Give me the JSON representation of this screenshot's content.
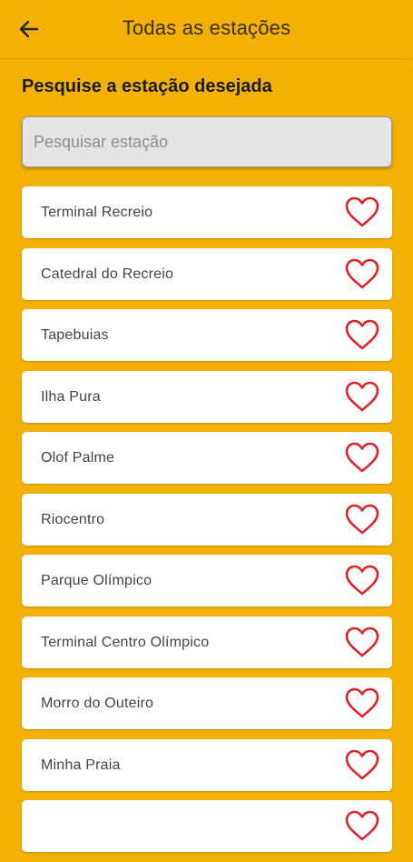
{
  "header": {
    "back_icon": "arrow-left-icon",
    "title": "Todas as estações"
  },
  "search": {
    "heading": "Pesquise a estação desejada",
    "placeholder": "Pesquisar estação",
    "value": ""
  },
  "favorite_icon": "heart-outline-icon",
  "colors": {
    "background": "#F2B104",
    "heart": "#E0232B",
    "card": "#FFFFFF"
  },
  "stations": [
    {
      "name": "Terminal Recreio",
      "favorite": false
    },
    {
      "name": "Catedral do Recreio",
      "favorite": false
    },
    {
      "name": "Tapebuias",
      "favorite": false
    },
    {
      "name": "Ilha Pura",
      "favorite": false
    },
    {
      "name": "Olof Palme",
      "favorite": false
    },
    {
      "name": "Riocentro",
      "favorite": false
    },
    {
      "name": "Parque Olímpico",
      "favorite": false
    },
    {
      "name": "Terminal Centro Olímpico",
      "favorite": false
    },
    {
      "name": "Morro do Outeiro",
      "favorite": false
    },
    {
      "name": "Minha Praia",
      "favorite": false
    },
    {
      "name": "",
      "favorite": false
    }
  ]
}
